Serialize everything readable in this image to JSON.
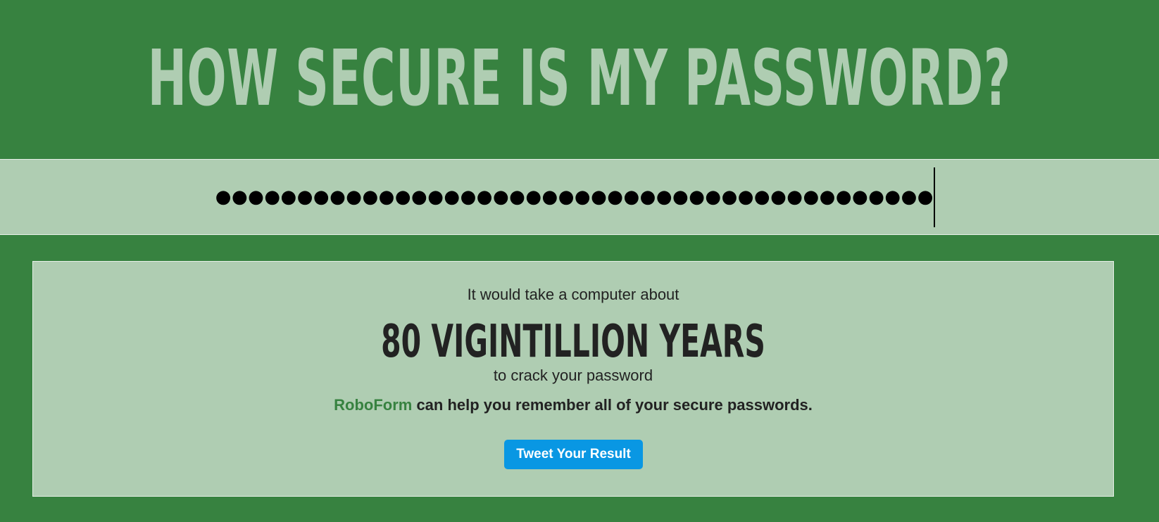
{
  "header": {
    "title": "HOW SECURE IS MY PASSWORD?"
  },
  "password_field": {
    "masked_value": "●●●●●●●●●●●●●●●●●●●●●●●●●●●●●●●●●●●●●●●●●●●●"
  },
  "result": {
    "intro": "It would take a computer about",
    "time": "80 VIGINTILLION YEARS",
    "outro": "to crack your password"
  },
  "promo": {
    "brand": "RoboForm",
    "text": " can help you remember all of your secure passwords."
  },
  "tweet_button": {
    "label": "Tweet Your Result"
  },
  "colors": {
    "background": "#378240",
    "panel": "#afcdb2",
    "title": "#afcdb2",
    "text": "#222222",
    "brand": "#378240",
    "button": "#0997e3"
  }
}
